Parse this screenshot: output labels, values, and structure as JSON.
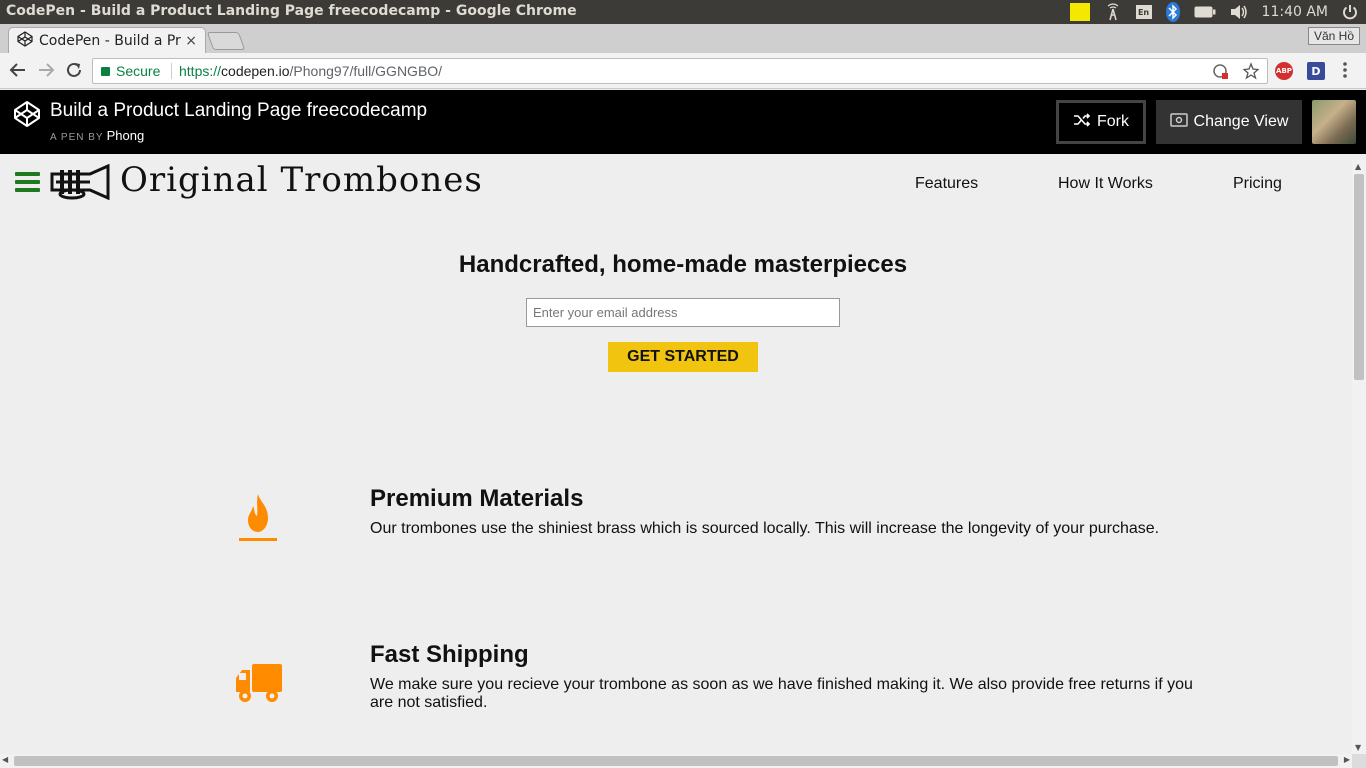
{
  "os": {
    "window_title": "CodePen - Build a Product Landing Page freecodecamp - Google Chrome",
    "clock": "11:40 AM",
    "keyboard_layout": "En"
  },
  "browser": {
    "tab_title": "CodePen - Build a Pr",
    "tab_close": "×",
    "profile_name": "Văn Hồ",
    "secure_label": "Secure",
    "url_protocol": "https://",
    "url_host": "codepen.io",
    "url_path": "/Phong97/full/GGNGBO/",
    "extensions": [
      "ABP",
      "D"
    ]
  },
  "codepen": {
    "pen_title": "Build a Product Landing Page freecodecamp",
    "by_label": "A PEN BY",
    "author": "Phong",
    "fork_label": "Fork",
    "change_view_label": "Change View"
  },
  "site": {
    "brand": "Original Trombones",
    "nav": [
      "Features",
      "How It Works",
      "Pricing"
    ],
    "hero_title": "Handcrafted, home-made masterpieces",
    "email_placeholder": "Enter your email address",
    "cta_label": "GET STARTED",
    "accent_color": "#ff8c00",
    "features": [
      {
        "icon": "fire-icon",
        "title": "Premium Materials",
        "description": "Our trombones use the shiniest brass which is sourced locally. This will increase the longevity of your purchase."
      },
      {
        "icon": "truck-icon",
        "title": "Fast Shipping",
        "description": "We make sure you recieve your trombone as soon as we have finished making it. We also provide free returns if you are not satisfied."
      }
    ]
  }
}
